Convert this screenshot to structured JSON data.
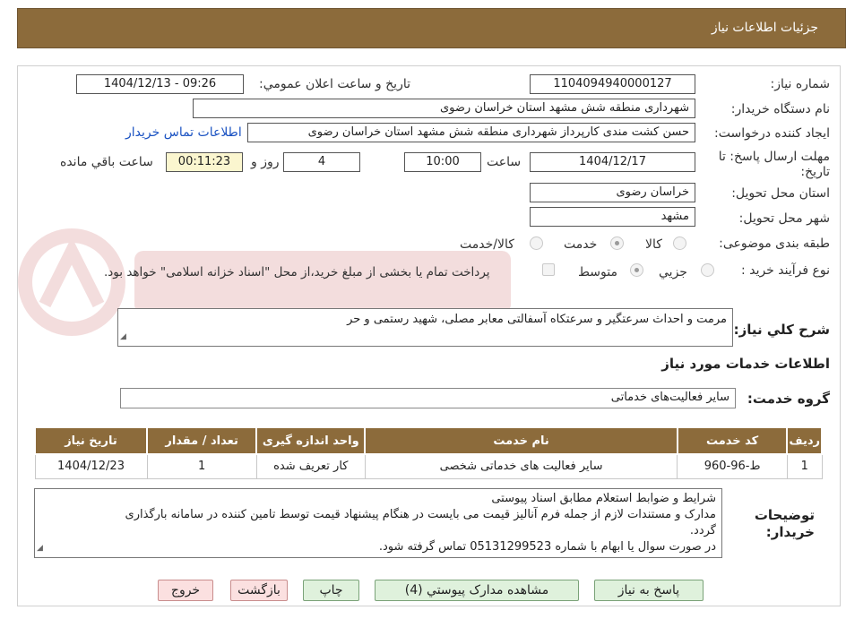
{
  "header": {
    "title": "جزئیات اطلاعات نیاز"
  },
  "form": {
    "need_number": {
      "label": "شماره نیاز:",
      "value": "1104094940000127"
    },
    "announce_datetime": {
      "label": "تاریخ و ساعت اعلان عمومي:",
      "value": "1404/12/13 - 09:26"
    },
    "buyer_org": {
      "label": "نام دستگاه خریدار:",
      "value": "شهرداری منطقه شش مشهد استان خراسان رضوی"
    },
    "requester": {
      "label": "ایجاد کننده درخواست:",
      "value": "حسن کشت مندی کارپرداز شهرداری منطقه شش مشهد استان خراسان رضوی",
      "contact_link": "اطلاعات تماس خریدار"
    },
    "deadline": {
      "label_line1": "مهلت ارسال پاسخ: تا",
      "label_line2": "تاریخ:",
      "date": "1404/12/17",
      "time_label": "ساعت",
      "time": "10:00",
      "days": "4",
      "days_label": "روز و",
      "remaining": "00:11:23",
      "remaining_label": "ساعت باقي مانده"
    },
    "province": {
      "label": "استان محل تحویل:",
      "value": "خراسان رضوی"
    },
    "city": {
      "label": "شهر محل تحویل:",
      "value": "مشهد"
    },
    "category": {
      "label": "طبقه بندی موضوعی:",
      "options": [
        {
          "label": "کالا",
          "checked": false
        },
        {
          "label": "خدمت",
          "checked": true
        },
        {
          "label": "کالا/خدمت",
          "checked": false
        }
      ]
    },
    "purchase_process": {
      "label": "نوع فرآیند خرید :",
      "options": [
        {
          "label": "جزيي",
          "checked": false
        },
        {
          "label": "متوسط",
          "checked": true
        }
      ],
      "note": "پرداخت تمام یا بخشی از مبلغ خرید،از محل \"اسناد خزانه اسلامی\" خواهد بود."
    }
  },
  "description": {
    "label": "شرح کلي نياز:",
    "value": "مرمت و احداث سرعتگیر و سرعتکاه آسفالتی معابر مصلی، شهید رستمی و حر"
  },
  "services_section": {
    "title": "اطلاعات خدمات مورد نياز",
    "group_label": "گروه خدمت:",
    "group_value": "سایر فعالیت‌های خدماتی",
    "columns": [
      "رديف",
      "کد خدمت",
      "نام خدمت",
      "واحد اندازه گیری",
      "تعداد / مقدار",
      "تاریخ نیاز"
    ],
    "rows": [
      [
        "1",
        "ط-96-960",
        "سایر فعالیت های خدماتی شخصی",
        "کار تعریف شده",
        "1",
        "1404/12/23"
      ]
    ]
  },
  "buyer_notes": {
    "label_line1": "توضیحات",
    "label_line2": "خریدار:",
    "lines": [
      "شرایط و ضوابط استعلام مطابق اسناد پیوستی",
      "مدارک و مستندات لازم از جمله فرم آنالیز قیمت می بایست در هنگام پیشنهاد قیمت توسط تامین کننده در سامانه بارگذاری",
      "گردد.",
      "در صورت سوال یا ابهام با شماره 05131299523 تماس گرفته شود."
    ]
  },
  "buttons": {
    "respond": "پاسخ به نیاز",
    "attachments": "مشاهده مدارک پیوستي (4)",
    "print": "چاپ",
    "back": "بازگشت",
    "exit": "خروج"
  },
  "colors": {
    "header_bg": "#8c6b3b",
    "link": "#1a52c2",
    "button_green": "#dff1dc",
    "button_red": "#fbe0e0"
  }
}
